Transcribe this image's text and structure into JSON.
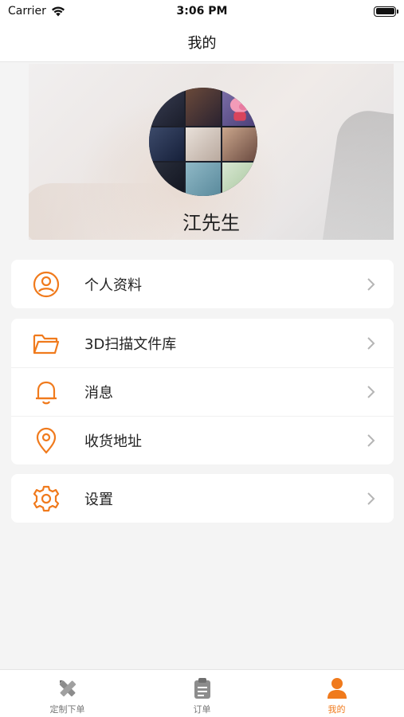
{
  "status_bar": {
    "carrier": "Carrier",
    "time": "3:06 PM"
  },
  "nav": {
    "title": "我的"
  },
  "profile": {
    "name": "江先生"
  },
  "menu_groups": [
    [
      {
        "label": "个人资料",
        "icon": "user-circle-icon"
      }
    ],
    [
      {
        "label": "3D扫描文件库",
        "icon": "folder-icon"
      },
      {
        "label": "消息",
        "icon": "bell-icon"
      },
      {
        "label": "收货地址",
        "icon": "location-pin-icon"
      }
    ],
    [
      {
        "label": "设置",
        "icon": "gear-icon"
      }
    ]
  ],
  "tabs": [
    {
      "label": "定制下单",
      "icon": "pencil-ruler-icon",
      "active": false
    },
    {
      "label": "订单",
      "icon": "clipboard-icon",
      "active": false
    },
    {
      "label": "我的",
      "icon": "person-icon",
      "active": true
    }
  ],
  "colors": {
    "accent": "#f07a1c",
    "inactive": "#777777",
    "background": "#f4f4f4"
  }
}
